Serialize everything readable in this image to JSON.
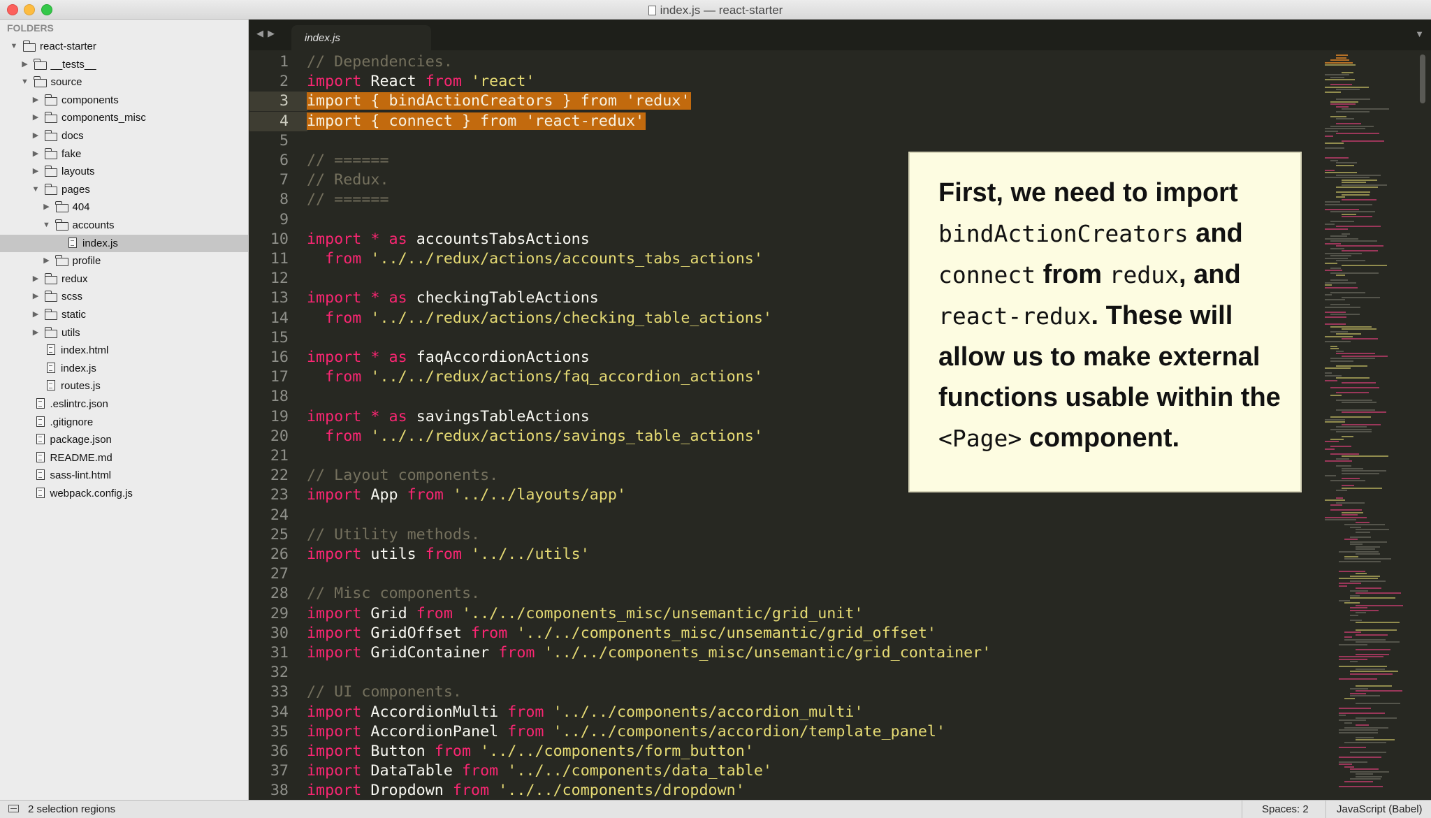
{
  "window": {
    "title": "index.js — react-starter"
  },
  "sidebar": {
    "header": "FOLDERS",
    "items": [
      {
        "label": "react-starter",
        "type": "folder",
        "depth": 0,
        "expanded": true
      },
      {
        "label": "__tests__",
        "type": "folder",
        "depth": 1,
        "expanded": false
      },
      {
        "label": "source",
        "type": "folder",
        "depth": 1,
        "expanded": true
      },
      {
        "label": "components",
        "type": "folder",
        "depth": 2,
        "expanded": false
      },
      {
        "label": "components_misc",
        "type": "folder",
        "depth": 2,
        "expanded": false
      },
      {
        "label": "docs",
        "type": "folder",
        "depth": 2,
        "expanded": false
      },
      {
        "label": "fake",
        "type": "folder",
        "depth": 2,
        "expanded": false
      },
      {
        "label": "layouts",
        "type": "folder",
        "depth": 2,
        "expanded": false
      },
      {
        "label": "pages",
        "type": "folder",
        "depth": 2,
        "expanded": true
      },
      {
        "label": "404",
        "type": "folder",
        "depth": 3,
        "expanded": false
      },
      {
        "label": "accounts",
        "type": "folder",
        "depth": 3,
        "expanded": true
      },
      {
        "label": "index.js",
        "type": "file",
        "depth": 4,
        "selected": true
      },
      {
        "label": "profile",
        "type": "folder",
        "depth": 3,
        "expanded": false
      },
      {
        "label": "redux",
        "type": "folder",
        "depth": 2,
        "expanded": false
      },
      {
        "label": "scss",
        "type": "folder",
        "depth": 2,
        "expanded": false
      },
      {
        "label": "static",
        "type": "folder",
        "depth": 2,
        "expanded": false
      },
      {
        "label": "utils",
        "type": "folder",
        "depth": 2,
        "expanded": false
      },
      {
        "label": "index.html",
        "type": "file",
        "depth": 2
      },
      {
        "label": "index.js",
        "type": "file",
        "depth": 2
      },
      {
        "label": "routes.js",
        "type": "file",
        "depth": 2
      },
      {
        "label": ".eslintrc.json",
        "type": "file",
        "depth": 1
      },
      {
        "label": ".gitignore",
        "type": "file",
        "depth": 1
      },
      {
        "label": "package.json",
        "type": "file",
        "depth": 1
      },
      {
        "label": "README.md",
        "type": "file",
        "depth": 1
      },
      {
        "label": "sass-lint.html",
        "type": "file",
        "depth": 1
      },
      {
        "label": "webpack.config.js",
        "type": "file",
        "depth": 1
      }
    ]
  },
  "tabs": [
    {
      "label": "index.js",
      "active": true
    }
  ],
  "editor": {
    "lines": [
      {
        "n": "1",
        "tokens": [
          [
            "c",
            "// Dependencies."
          ]
        ]
      },
      {
        "n": "2",
        "tokens": [
          [
            "k",
            "import"
          ],
          [
            "t",
            " React "
          ],
          [
            "k",
            "from"
          ],
          [
            "t",
            " "
          ],
          [
            "s",
            "'react'"
          ]
        ]
      },
      {
        "n": "3",
        "selected": true,
        "tokens": [
          [
            "t",
            "import { bindActionCreators } from 'redux'"
          ]
        ]
      },
      {
        "n": "4",
        "selected": true,
        "tokens": [
          [
            "t",
            "import { connect } from 'react-redux'"
          ]
        ]
      },
      {
        "n": "5",
        "tokens": []
      },
      {
        "n": "6",
        "tokens": [
          [
            "c",
            "// ======"
          ]
        ]
      },
      {
        "n": "7",
        "tokens": [
          [
            "c",
            "// Redux."
          ]
        ]
      },
      {
        "n": "8",
        "tokens": [
          [
            "c",
            "// ======"
          ]
        ]
      },
      {
        "n": "9",
        "tokens": []
      },
      {
        "n": "10",
        "tokens": [
          [
            "k",
            "import"
          ],
          [
            "t",
            " "
          ],
          [
            "k",
            "*"
          ],
          [
            "t",
            " "
          ],
          [
            "k",
            "as"
          ],
          [
            "t",
            " accountsTabsActions"
          ]
        ]
      },
      {
        "n": "11",
        "tokens": [
          [
            "t",
            "  "
          ],
          [
            "k",
            "from"
          ],
          [
            "t",
            " "
          ],
          [
            "s",
            "'../../redux/actions/accounts_tabs_actions'"
          ]
        ]
      },
      {
        "n": "12",
        "tokens": []
      },
      {
        "n": "13",
        "tokens": [
          [
            "k",
            "import"
          ],
          [
            "t",
            " "
          ],
          [
            "k",
            "*"
          ],
          [
            "t",
            " "
          ],
          [
            "k",
            "as"
          ],
          [
            "t",
            " checkingTableActions"
          ]
        ]
      },
      {
        "n": "14",
        "tokens": [
          [
            "t",
            "  "
          ],
          [
            "k",
            "from"
          ],
          [
            "t",
            " "
          ],
          [
            "s",
            "'../../redux/actions/checking_table_actions'"
          ]
        ]
      },
      {
        "n": "15",
        "tokens": []
      },
      {
        "n": "16",
        "tokens": [
          [
            "k",
            "import"
          ],
          [
            "t",
            " "
          ],
          [
            "k",
            "*"
          ],
          [
            "t",
            " "
          ],
          [
            "k",
            "as"
          ],
          [
            "t",
            " faqAccordionActions"
          ]
        ]
      },
      {
        "n": "17",
        "tokens": [
          [
            "t",
            "  "
          ],
          [
            "k",
            "from"
          ],
          [
            "t",
            " "
          ],
          [
            "s",
            "'../../redux/actions/faq_accordion_actions'"
          ]
        ]
      },
      {
        "n": "18",
        "tokens": []
      },
      {
        "n": "19",
        "tokens": [
          [
            "k",
            "import"
          ],
          [
            "t",
            " "
          ],
          [
            "k",
            "*"
          ],
          [
            "t",
            " "
          ],
          [
            "k",
            "as"
          ],
          [
            "t",
            " savingsTableActions"
          ]
        ]
      },
      {
        "n": "20",
        "tokens": [
          [
            "t",
            "  "
          ],
          [
            "k",
            "from"
          ],
          [
            "t",
            " "
          ],
          [
            "s",
            "'../../redux/actions/savings_table_actions'"
          ]
        ]
      },
      {
        "n": "21",
        "tokens": []
      },
      {
        "n": "22",
        "tokens": [
          [
            "c",
            "// Layout components."
          ]
        ]
      },
      {
        "n": "23",
        "tokens": [
          [
            "k",
            "import"
          ],
          [
            "t",
            " App "
          ],
          [
            "k",
            "from"
          ],
          [
            "t",
            " "
          ],
          [
            "s",
            "'../../layouts/app'"
          ]
        ]
      },
      {
        "n": "24",
        "tokens": []
      },
      {
        "n": "25",
        "tokens": [
          [
            "c",
            "// Utility methods."
          ]
        ]
      },
      {
        "n": "26",
        "tokens": [
          [
            "k",
            "import"
          ],
          [
            "t",
            " utils "
          ],
          [
            "k",
            "from"
          ],
          [
            "t",
            " "
          ],
          [
            "s",
            "'../../utils'"
          ]
        ]
      },
      {
        "n": "27",
        "tokens": []
      },
      {
        "n": "28",
        "tokens": [
          [
            "c",
            "// Misc components."
          ]
        ]
      },
      {
        "n": "29",
        "tokens": [
          [
            "k",
            "import"
          ],
          [
            "t",
            " Grid "
          ],
          [
            "k",
            "from"
          ],
          [
            "t",
            " "
          ],
          [
            "s",
            "'../../components_misc/unsemantic/grid_unit'"
          ]
        ]
      },
      {
        "n": "30",
        "tokens": [
          [
            "k",
            "import"
          ],
          [
            "t",
            " GridOffset "
          ],
          [
            "k",
            "from"
          ],
          [
            "t",
            " "
          ],
          [
            "s",
            "'../../components_misc/unsemantic/grid_offset'"
          ]
        ]
      },
      {
        "n": "31",
        "tokens": [
          [
            "k",
            "import"
          ],
          [
            "t",
            " GridContainer "
          ],
          [
            "k",
            "from"
          ],
          [
            "t",
            " "
          ],
          [
            "s",
            "'../../components_misc/unsemantic/grid_container'"
          ]
        ]
      },
      {
        "n": "32",
        "tokens": []
      },
      {
        "n": "33",
        "tokens": [
          [
            "c",
            "// UI components."
          ]
        ]
      },
      {
        "n": "34",
        "tokens": [
          [
            "k",
            "import"
          ],
          [
            "t",
            " AccordionMulti "
          ],
          [
            "k",
            "from"
          ],
          [
            "t",
            " "
          ],
          [
            "s",
            "'../../components/accordion_multi'"
          ]
        ]
      },
      {
        "n": "35",
        "tokens": [
          [
            "k",
            "import"
          ],
          [
            "t",
            " AccordionPanel "
          ],
          [
            "k",
            "from"
          ],
          [
            "t",
            " "
          ],
          [
            "s",
            "'../../components/accordion/template_panel'"
          ]
        ]
      },
      {
        "n": "36",
        "tokens": [
          [
            "k",
            "import"
          ],
          [
            "t",
            " Button "
          ],
          [
            "k",
            "from"
          ],
          [
            "t",
            " "
          ],
          [
            "s",
            "'../../components/form_button'"
          ]
        ]
      },
      {
        "n": "37",
        "tokens": [
          [
            "k",
            "import"
          ],
          [
            "t",
            " DataTable "
          ],
          [
            "k",
            "from"
          ],
          [
            "t",
            " "
          ],
          [
            "s",
            "'../../components/data_table'"
          ]
        ]
      },
      {
        "n": "38",
        "tokens": [
          [
            "k",
            "import"
          ],
          [
            "t",
            " Dropdown "
          ],
          [
            "k",
            "from"
          ],
          [
            "t",
            " "
          ],
          [
            "s",
            "'../../components/dropdown'"
          ]
        ]
      }
    ]
  },
  "callout": {
    "parts": [
      [
        "b",
        "First, we need to import "
      ],
      [
        "m",
        "bindActionCreators"
      ],
      [
        "b",
        " and "
      ],
      [
        "m",
        "connect"
      ],
      [
        "b",
        " from "
      ],
      [
        "m",
        "redux"
      ],
      [
        "b",
        ", and "
      ],
      [
        "m",
        "react-redux"
      ],
      [
        "b",
        ". These will allow us to make external functions usable within the "
      ],
      [
        "m",
        "<Page>"
      ],
      [
        "b",
        " component."
      ]
    ]
  },
  "statusbar": {
    "selection": "2 selection regions",
    "indentation": "Spaces: 2",
    "syntax": "JavaScript (Babel)"
  },
  "colors": {
    "editor_bg": "#272822",
    "keyword": "#f92672",
    "string": "#e6db74",
    "comment": "#75715e",
    "selection": "#c26a0e",
    "callout_bg": "#fdfce1"
  }
}
